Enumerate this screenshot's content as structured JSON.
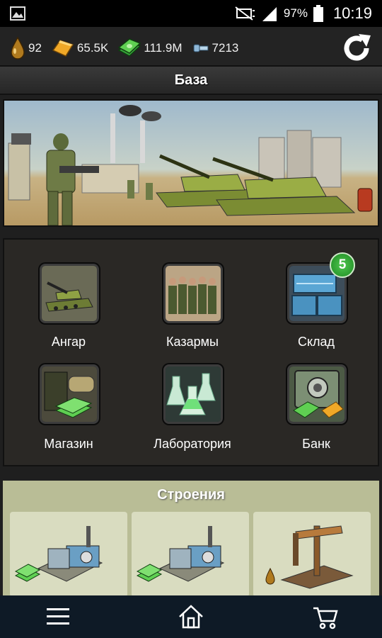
{
  "status_bar": {
    "battery_percent": "97%",
    "time": "10:19",
    "icons": [
      "gallery-icon",
      "mute-icon",
      "signal-icon",
      "battery-icon"
    ]
  },
  "resources": [
    {
      "icon": "oil-drop-icon",
      "value": "92"
    },
    {
      "icon": "gold-bar-icon",
      "value": "65.5K"
    },
    {
      "icon": "cash-stack-icon",
      "value": "111.9M"
    },
    {
      "icon": "bolt-icon",
      "value": "7213"
    }
  ],
  "base_header": {
    "title": "База"
  },
  "menu": {
    "items": [
      {
        "label": "Ангар",
        "icon": "tank-icon"
      },
      {
        "label": "Казармы",
        "icon": "soldiers-icon"
      },
      {
        "label": "Склад",
        "icon": "crates-icon",
        "badge": "5"
      },
      {
        "label": "Магазин",
        "icon": "ammo-shop-icon"
      },
      {
        "label": "Лаборатория",
        "icon": "flasks-icon"
      },
      {
        "label": "Банк",
        "icon": "safe-icon"
      }
    ]
  },
  "buildings": {
    "title": "Строения",
    "cards": [
      {
        "icon": "factory-cash-icon"
      },
      {
        "icon": "factory-cash-icon"
      },
      {
        "icon": "oil-pump-icon"
      }
    ]
  },
  "bottom_nav": {
    "items": [
      {
        "icon": "menu-icon"
      },
      {
        "icon": "home-icon"
      },
      {
        "icon": "cart-icon"
      }
    ]
  },
  "colors": {
    "accent_green": "#3fb043",
    "panel_dark": "#2a2825",
    "buildings_bg": "#b9bd96",
    "nav_bg": "#0e1a26"
  }
}
